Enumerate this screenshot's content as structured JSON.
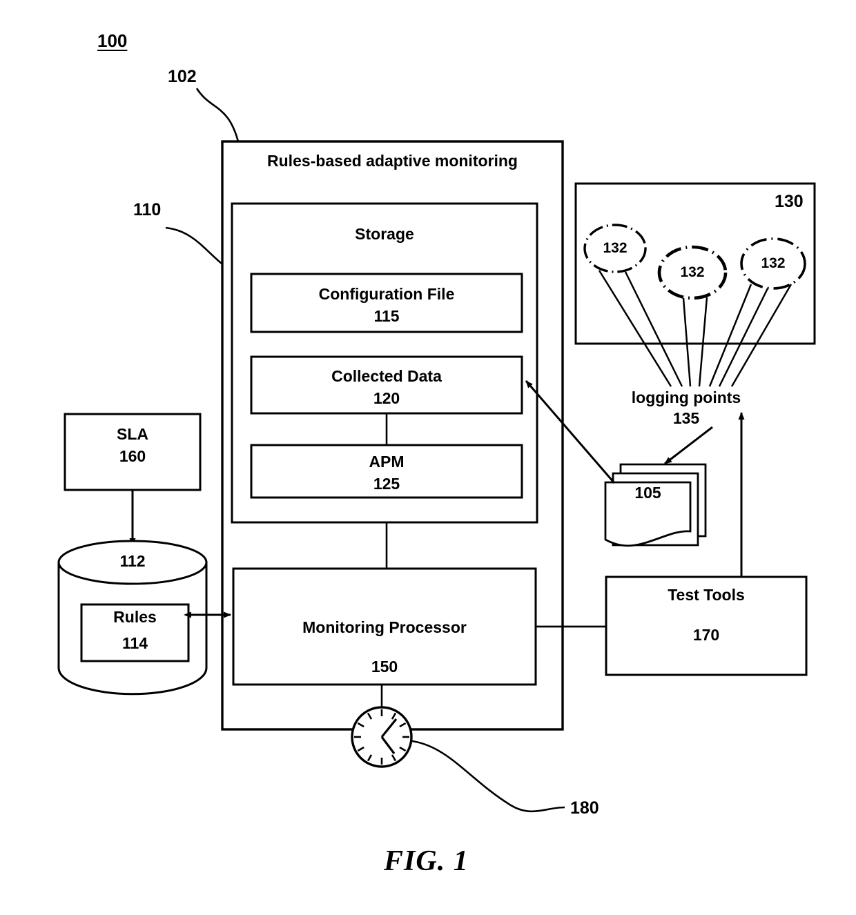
{
  "figure": {
    "system_number": "100",
    "caption": "FIG. 1"
  },
  "refs": {
    "system_ref": "102",
    "storage_ref": "110",
    "logging_points_ref": "135",
    "clock_ref": "180",
    "application_ref": "130",
    "documents_ref": "105",
    "db_ref": "112"
  },
  "system_box": {
    "title": "Rules-based adaptive monitoring"
  },
  "storage_box": {
    "title": "Storage",
    "items": [
      {
        "label": "Configuration File",
        "number": "115"
      },
      {
        "label": "Collected Data",
        "number": "120"
      },
      {
        "label": "APM",
        "number": "125"
      }
    ]
  },
  "monitoring_processor": {
    "label": "Monitoring Processor",
    "number": "150"
  },
  "sla": {
    "label": "SLA",
    "number": "160"
  },
  "database": {
    "number": "112",
    "rules": {
      "label": "Rules",
      "number": "114"
    }
  },
  "test_tools": {
    "label": "Test Tools",
    "number": "170"
  },
  "application_box": {
    "number": "130",
    "nodes": [
      {
        "number": "132"
      },
      {
        "number": "132"
      },
      {
        "number": "132"
      }
    ]
  },
  "logging_points": {
    "label": "logging points",
    "number": "135"
  },
  "documents": {
    "number": "105"
  },
  "clock": {
    "number": "180"
  },
  "colors": {
    "stroke": "#000000",
    "background": "#ffffff"
  }
}
